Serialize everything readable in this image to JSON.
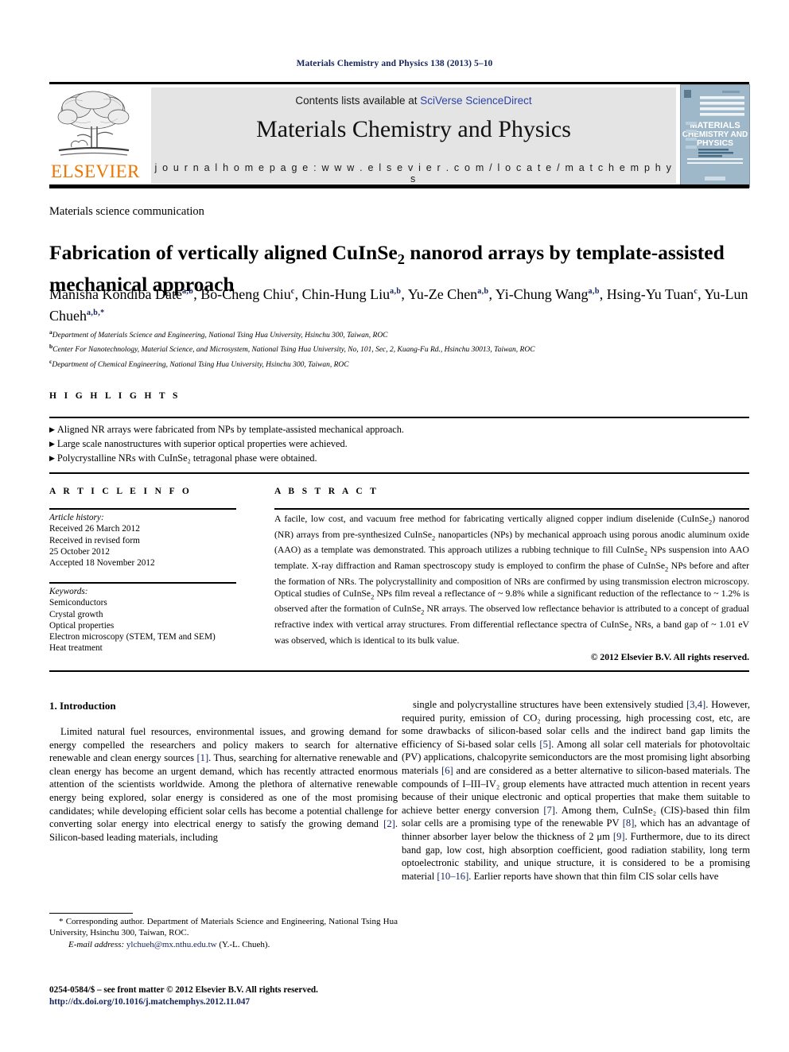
{
  "running_head": "Materials Chemistry and Physics 138 (2013) 5–10",
  "masthead": {
    "contents_prefix": "Contents lists available at ",
    "contents_link": "SciVerse ScienceDirect",
    "journal_title": "Materials Chemistry and Physics",
    "homepage": "j o u r n a l   h o m e p a g e :   w w w . e l s e v i e r . c o m / l o c a t e / m a t c h e m p h y s",
    "publisher_name": "ELSEVIER",
    "cover_line1": "MATERIALS",
    "cover_line2": "CHEMISTRY AND",
    "cover_line3": "PHYSICS",
    "link_color": "#2b43a8",
    "banner_bg": "#e4e4e4",
    "elsevier_orange": "#eb7500",
    "cover_blue": "#9db6c8"
  },
  "article": {
    "section_label": "Materials science communication",
    "title_part1": "Fabrication of vertically aligned CuInSe",
    "title_sub": "2",
    "title_part2": " nanorod arrays by template-assisted mechanical approach",
    "authors": [
      {
        "name": "Manisha Kondiba Date",
        "sup": "a,b",
        "sep": ", "
      },
      {
        "name": "Bo-Cheng Chiu",
        "sup": "c",
        "sep": ", "
      },
      {
        "name": "Chin-Hung Liu",
        "sup": "a,b",
        "sep": ", "
      },
      {
        "name": "Yu-Ze Chen",
        "sup": "a,b",
        "sep": ", "
      },
      {
        "name": "Yi-Chung Wang",
        "sup": "a,b",
        "sep": ", "
      },
      {
        "name": "Hsing-Yu Tuan",
        "sup": "c",
        "sep": ", "
      },
      {
        "name": "Yu-Lun Chueh",
        "sup": "a,b,*",
        "sep": ""
      }
    ],
    "affiliations": [
      {
        "mark": "a",
        "text": "Department of Materials Science and Engineering, National Tsing Hua University, Hsinchu 300, Taiwan, ROC"
      },
      {
        "mark": "b",
        "text": "Center For Nanotechnology, Material Science, and Microsystem, National Tsing Hua University, No, 101, Sec, 2, Kuang-Fu Rd., Hsinchu 30013, Taiwan, ROC"
      },
      {
        "mark": "c",
        "text": "Department of Chemical Engineering, National Tsing Hua University, Hsinchu 300, Taiwan, ROC"
      }
    ]
  },
  "highlights": {
    "heading": "H I G H L I G H T S",
    "items": [
      "Aligned NR arrays were fabricated from NPs by template-assisted mechanical approach.",
      "Large scale nanostructures with superior optical properties were achieved.",
      "Polycrystalline NRs with CuInSe₂ tetragonal phase were obtained."
    ]
  },
  "article_info": {
    "heading": "A R T I C L E   I N F O",
    "history_label": "Article history:",
    "history_lines": [
      "Received 26 March 2012",
      "Received in revised form",
      "25 October 2012",
      "Accepted 18 November 2012"
    ],
    "keywords_label": "Keywords:",
    "keywords": [
      "Semiconductors",
      "Crystal growth",
      "Optical properties",
      "Electron microscopy (STEM, TEM and SEM)",
      "Heat treatment"
    ]
  },
  "abstract": {
    "heading": "A B S T R A C T",
    "text_parts": [
      "A facile, low cost, and vacuum free method for fabricating vertically aligned copper indium diselenide (CuInSe",
      "2",
      ") nanorod (NR) arrays from pre-synthesized CuInSe",
      "2",
      " nanoparticles (NPs) by mechanical approach using porous anodic aluminum oxide (AAO) as a template was demonstrated. This approach utilizes a rubbing technique to fill CuInSe",
      "2",
      " NPs suspension into AAO template. X-ray diffraction and Raman spectroscopy study is employed to confirm the phase of CuInSe",
      "2",
      " NPs before and after the formation of NRs. The polycrystallinity and composition of NRs are confirmed by using transmission electron microscopy. Optical studies of CuInSe",
      "2",
      " NPs film reveal a reflectance of ~ 9.8% while a significant reduction of the reflectance to ~ 1.2% is observed after the formation of CuInSe",
      "2",
      " NR arrays. The observed low reflectance behavior is attributed to a concept of gradual refractive index with vertical array structures. From differential reflectance spectra of CuInSe",
      "2",
      " NRs, a band gap of ~ 1.01 eV was observed, which is identical to its bulk value."
    ],
    "copyright": "© 2012 Elsevier B.V. All rights reserved."
  },
  "body": {
    "section_number_title": "1.  Introduction",
    "left_column": [
      "Limited natural fuel resources, environmental issues, and growing demand for energy compelled the researchers and policy makers to search for alternative renewable and clean energy sources ",
      "[1]",
      ". Thus, searching for alternative renewable and clean energy has become an urgent demand, which has recently attracted enormous attention of the scientists worldwide. Among the plethora of alternative renewable energy being explored, solar energy is considered as one of the most promising candidates; while developing efficient solar cells has become a potential challenge for converting solar energy into electrical energy to satisfy the growing demand ",
      "[2]",
      ". Silicon-based leading materials, including"
    ],
    "right_column": [
      "single and polycrystalline structures have been extensively studied ",
      "[3,4]",
      ". However, required purity, emission of CO₂ during processing, high processing cost, etc, are some drawbacks of silicon-based solar cells and the indirect band gap limits the efficiency of Si-based solar cells ",
      "[5]",
      ". Among all solar cell materials for photovoltaic (PV) applications, chalcopyrite semiconductors are the most promising light absorbing materials ",
      "[6]",
      " and are considered as a better alternative to silicon-based materials. The compounds of I–III–IV₂ group elements have attracted much attention in recent years because of their unique electronic and optical properties that make them suitable to achieve better energy conversion ",
      "[7]",
      ". Among them, CuInSe₂ (CIS)-based thin film solar cells are a promising type of the renewable PV ",
      "[8]",
      ", which has an advantage of thinner absorber layer below the thickness of 2 μm ",
      "[9]",
      ". Furthermore, due to its direct band gap, low cost, high absorption coefficient, good radiation stability, long term optoelectronic stability, and unique structure, it is considered to be a promising material ",
      "[10–16]",
      ". Earlier reports have shown that thin film CIS solar cells have"
    ]
  },
  "footnotes": {
    "corresponding": "* Corresponding author. Department of Materials Science and Engineering, National Tsing Hua University, Hsinchu 300, Taiwan, ROC.",
    "email_label": "E-mail address:",
    "email": "ylchueh@mx.nthu.edu.tw",
    "email_suffix": "(Y.-L. Chueh).",
    "imprint_line": "0254-0584/$ – see front matter © 2012 Elsevier B.V. All rights reserved.",
    "doi": "http://dx.doi.org/10.1016/j.matchemphys.2012.11.047"
  }
}
